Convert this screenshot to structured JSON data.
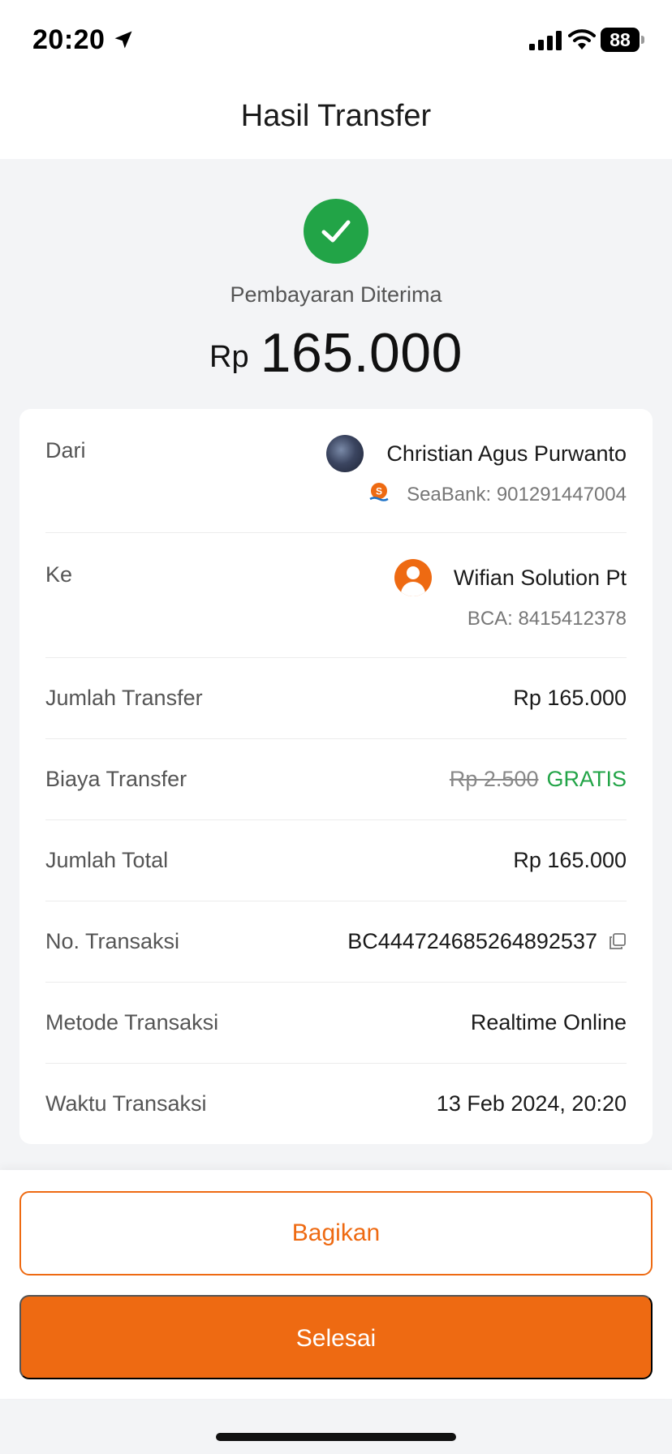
{
  "status_bar": {
    "time": "20:20",
    "battery": "88"
  },
  "header": {
    "title": "Hasil Transfer"
  },
  "result": {
    "status": "Pembayaran Diterima",
    "currency": "Rp",
    "amount": "165.000"
  },
  "details": {
    "from": {
      "label": "Dari",
      "name": "Christian Agus Purwanto",
      "bank": "SeaBank: 901291447004"
    },
    "to": {
      "label": "Ke",
      "name": "Wifian Solution Pt",
      "bank": "BCA: 8415412378"
    },
    "transfer_amount": {
      "label": "Jumlah Transfer",
      "value": "Rp 165.000"
    },
    "fee": {
      "label": "Biaya Transfer",
      "original": "Rp 2.500",
      "value": "GRATIS"
    },
    "total": {
      "label": "Jumlah Total",
      "value": "Rp 165.000"
    },
    "transaction_no": {
      "label": "No. Transaksi",
      "value": "BC444724685264892537"
    },
    "method": {
      "label": "Metode Transaksi",
      "value": "Realtime Online"
    },
    "time": {
      "label": "Waktu Transaksi",
      "value": "13 Feb 2024, 20:20"
    }
  },
  "actions": {
    "share_label": "Bagikan",
    "done_label": "Selesai"
  },
  "colors": {
    "accent": "#ee6a12",
    "success": "#22a447"
  },
  "icons": [
    "location-arrow-icon",
    "signal-icon",
    "wifi-icon",
    "battery-icon",
    "check-circle-icon",
    "seabank-icon",
    "user-icon",
    "copy-icon"
  ]
}
